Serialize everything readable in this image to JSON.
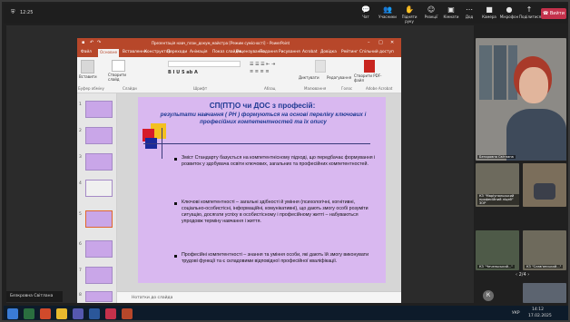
{
  "teams": {
    "time": "12:25",
    "buttons": [
      "Чат",
      "Учасники",
      "Підняти руку",
      "Реакції",
      "Кімнати",
      "Дод",
      "Камера",
      "Мікрофон",
      "Поділитися"
    ],
    "leave": "Вийти"
  },
  "powerpoint": {
    "title": "Презентація навч_план_докум_майстра [Режим сумісності] – PowerPoint",
    "menu": [
      "Файл",
      "Основне",
      "Вставлення",
      "Конструктор",
      "Переходи",
      "Анімація",
      "Показ слайдів",
      "Рецензування",
      "Подання",
      "Рисування",
      "Acrobat",
      "Довідка",
      "Рейтинг",
      "Спільний доступ"
    ],
    "ribbon_groups": [
      "Буфер обміну",
      "Слайди",
      "Шрифт",
      "Абзац",
      "Малювання",
      "Редагування",
      "Голос",
      "Adobe Acrobat"
    ],
    "ribbon_buttons": {
      "paste": "Вставити",
      "new_slide": "Створити слайд",
      "voice": "Диктувати",
      "edit": "Редагування",
      "pdf": "Створити PDF-файл"
    },
    "thumbs": [
      "1",
      "2",
      "3",
      "4",
      "5",
      "6",
      "7",
      "8"
    ],
    "notes": "Нотатки до слайда"
  },
  "slide": {
    "title": "СП(ПТ)О чи ДОС з професій:",
    "subtitle": "результати навчання ( РН ) формуються на основі переліку ключових і професійних компетентностей та їх опису",
    "b1": "Зміст Стандарту базується на компетентнісному підході, що передбачає формування і розвиток у здобувача освіти ключових, загальних та професійних компетентностей.",
    "b2": "Ключові компетентності – загальні здібності й уміння (психологічні, когнітивні, соціально-особистісні, інформаційні, комунікативні), що дають змогу особі розуміти ситуацію, досягати успіху в особистісному і професійному житті – набуваються упродовж терміну навчання і життя.",
    "b3": "Професійні компетентності – знання та уміння особи, які дають їй змогу виконувати трудові функції та є складовими відповідної професійної кваліфікації."
  },
  "participant_name": "Безкровна Світлана",
  "gallery": {
    "main_label": "Безкровна Світлана",
    "t2": "КЗ \"Маріупольський професійний ліцей\" ЗОР",
    "t3": "КЗ \"Вищий професійний...\"",
    "t4": "КЗ \"Чечельський...\"",
    "t5": "КЗ \"Слав'янський...\"",
    "page": "2/4",
    "avatar": "К"
  },
  "taskbar": {
    "lang": "УКР",
    "time": "14:12",
    "date": "17.02.2025"
  }
}
